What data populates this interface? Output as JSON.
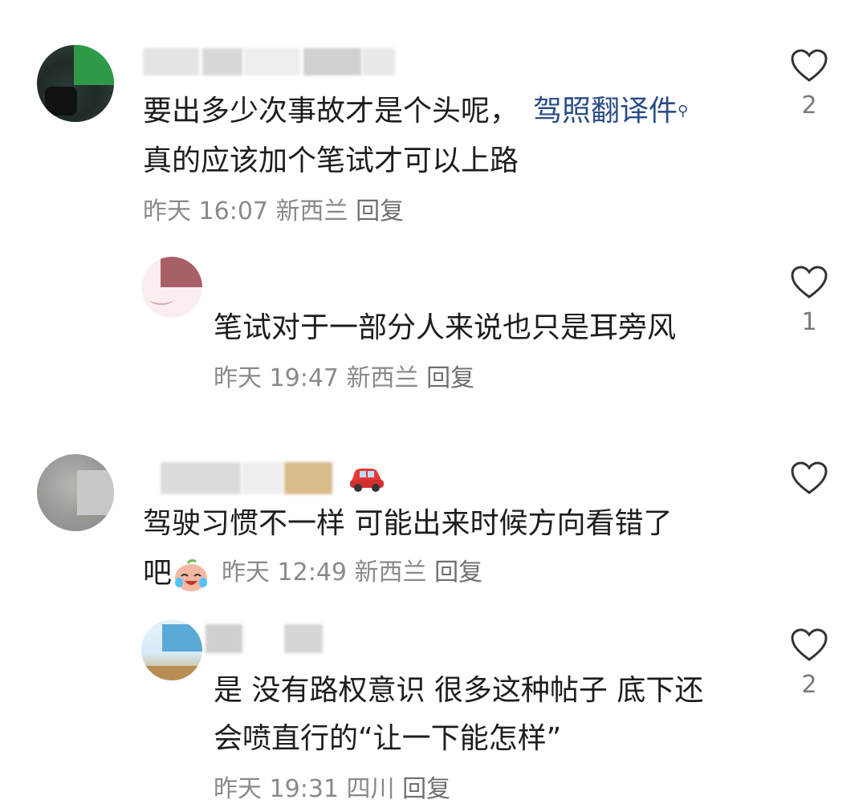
{
  "comments": [
    {
      "text_lines": [
        "要出多少次事故才是个头呢，",
        "真的应该加个笔试才可以上路"
      ],
      "link_text": "驾照翻译件",
      "time": "昨天 16:07",
      "location": "新西兰",
      "reply_label": "回复",
      "likes": "2"
    },
    {
      "text_lines": [
        "笔试对于一部分人来说也只是耳旁风"
      ],
      "time": "昨天 19:47",
      "location": "新西兰",
      "reply_label": "回复",
      "likes": "1"
    },
    {
      "text_lines": [
        "驾驶习惯不一样 可能出来时候方向看错了",
        "吧"
      ],
      "time": "昨天 12:49",
      "location": "新西兰",
      "reply_label": "回复",
      "likes": ""
    },
    {
      "text_lines": [
        "是 没有路权意识 很多这种帖子 底下还",
        "会喷直行的“让一下能怎样”"
      ],
      "time": "昨天 19:31",
      "location": "四川",
      "reply_label": "回复",
      "likes": "2"
    }
  ],
  "icons": {
    "like": "heart-outline-icon",
    "search_hint": "magnifier-icon",
    "car_emoji": "red-car-emoji",
    "laugh_cry_emoji": "laughing-crying-emoji"
  },
  "colors": {
    "link": "#2c4d86",
    "meta": "#8a8a8a",
    "text": "#1d1d1d"
  }
}
